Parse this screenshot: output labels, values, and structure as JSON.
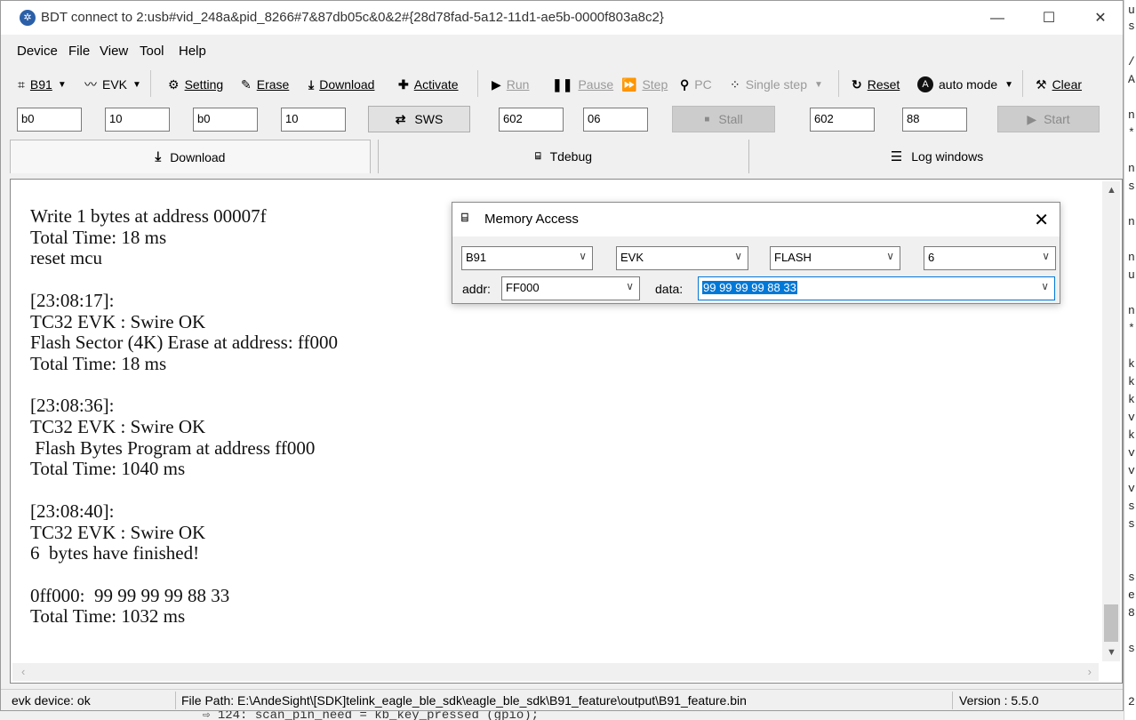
{
  "window": {
    "title": "BDT connect to 2:usb#vid_248a&pid_8266#7&87db05c&0&2#{28d78fad-5a12-11d1-ae5b-0000f803a8c2}",
    "minimize": "—",
    "maximize": "☐",
    "close": "✕"
  },
  "menu": [
    "Device",
    "File",
    "View",
    "Tool",
    "Help"
  ],
  "toolbar": {
    "chip": "B91",
    "board": "EVK",
    "setting": "Setting",
    "erase": "Erase",
    "download": "Download",
    "activate": "Activate",
    "run": "Run",
    "pause": "Pause",
    "step": "Step",
    "pc": "PC",
    "single_step": "Single step",
    "reset": "Reset",
    "auto_mode": "auto mode",
    "clear": "Clear"
  },
  "fields": {
    "f1": "b0",
    "f2": "10",
    "f3": "b0",
    "f4": "10",
    "sws": "SWS",
    "f5": "602",
    "f6": "06",
    "stall": "Stall",
    "f7": "602",
    "f8": "88",
    "start": "Start"
  },
  "tabs": {
    "download": "Download",
    "tdebug": "Tdebug",
    "log": "Log windows"
  },
  "log_text": "Write 1 bytes at address 00007f\nTotal Time: 18 ms\nreset mcu\n\n[23:08:17]:\nTC32 EVK : Swire OK\nFlash Sector (4K) Erase at address: ff000\nTotal Time: 18 ms\n\n[23:08:36]:\nTC32 EVK : Swire OK\n Flash Bytes Program at address ff000\nTotal Time: 1040 ms\n\n[23:08:40]:\nTC32 EVK : Swire OK\n6  bytes have finished!\n\n0ff000:  99 99 99 99 88 33\nTotal Time: 1032 ms",
  "statusbar": {
    "device": "evk device: ok",
    "file_path": "File Path:  E:\\AndeSight\\[SDK]telink_eagle_ble_sdk\\eagle_ble_sdk\\B91_feature\\output\\B91_feature.bin",
    "version": "Version : 5.5.0"
  },
  "dialog": {
    "title": "Memory Access",
    "chip": "B91",
    "board": "EVK",
    "memory": "FLASH",
    "count": "6",
    "addr_label": "addr:",
    "addr": "FF000",
    "data_label": "data:",
    "data": "99 99 99 99 88 33"
  },
  "background": {
    "bottom_code": "⇨ 124: scan_pin_need = kb_key_pressed (gpio);",
    "right_chars": [
      "u",
      "s",
      "/",
      "A",
      "n",
      "*",
      "n",
      "s",
      "n",
      "n",
      "u",
      "n",
      "*",
      "k",
      "k",
      "k",
      "v",
      "k",
      "v",
      "v",
      "v",
      "s",
      "s",
      "s",
      "e",
      "8",
      "s",
      "2"
    ]
  }
}
